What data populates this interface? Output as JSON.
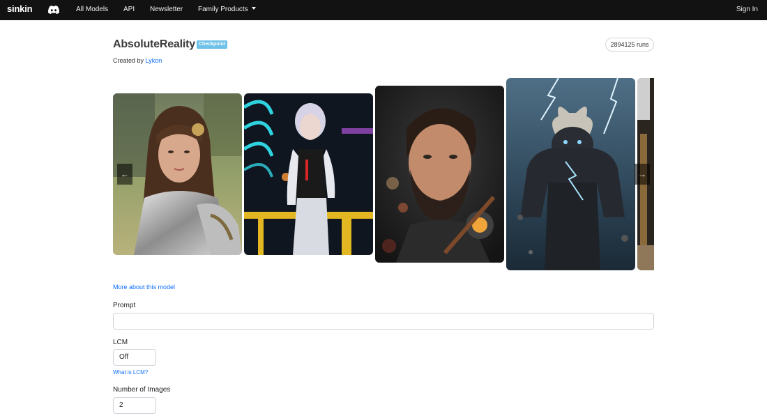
{
  "nav": {
    "brand": "sinkin",
    "links": [
      "All Models",
      "API",
      "Newsletter",
      "Family Products"
    ],
    "sign_in": "Sign In"
  },
  "model": {
    "name": "AbsoluteReality",
    "badge": "Checkpoint",
    "created_prefix": "Created by ",
    "author": "Lykon",
    "runs": "2894125 runs"
  },
  "carousel": {
    "prev_icon": "arrow-left-icon",
    "next_icon": "arrow-right-icon",
    "slides": [
      "woman-in-armor-image",
      "cyberpunk-girl-image",
      "bearded-man-image",
      "stone-giant-lightning-image",
      "partial-image"
    ]
  },
  "form": {
    "more_link": "More about this model",
    "prompt_label": "Prompt",
    "prompt_value": "",
    "lcm_label": "LCM",
    "lcm_value": "Off",
    "lcm_help": "What is LCM?",
    "num_images_label": "Number of Images",
    "num_images_value": "2"
  },
  "colors": {
    "navbar_bg": "#121212",
    "badge_bg": "#6ec1e8",
    "link": "#0d6efd"
  }
}
